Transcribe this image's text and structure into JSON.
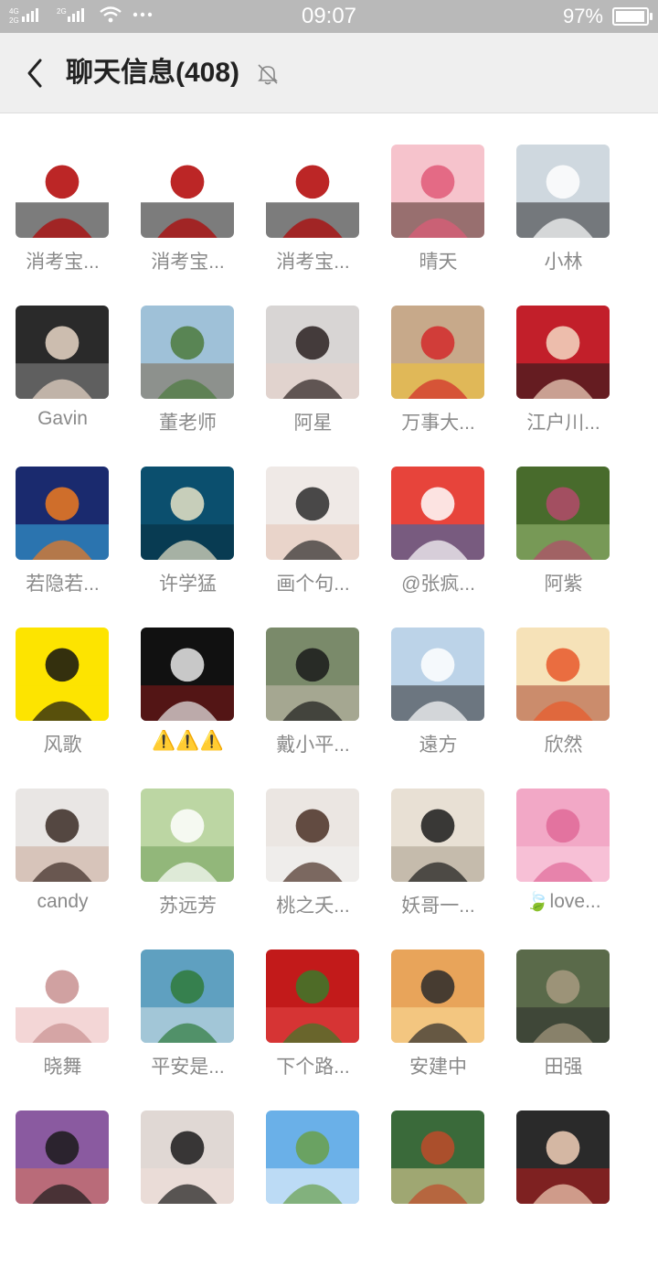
{
  "status_bar": {
    "network": "4G",
    "time": "09:07",
    "battery": "97%",
    "battery_level": 0.97
  },
  "header": {
    "title": "聊天信息(408)",
    "back_icon": "back-arrow-icon",
    "mute_icon": "bell-muted-icon"
  },
  "members": [
    {
      "name": "消考宝...",
      "avatar": [
        "#ffffff",
        "#b00000",
        "#111111"
      ]
    },
    {
      "name": "消考宝...",
      "avatar": [
        "#ffffff",
        "#b00000",
        "#111111"
      ]
    },
    {
      "name": "消考宝...",
      "avatar": [
        "#ffffff",
        "#b00000",
        "#111111"
      ]
    },
    {
      "name": "晴天",
      "avatar": [
        "#f6c3cc",
        "#e05b78",
        "#4a2a22"
      ]
    },
    {
      "name": "小林",
      "avatar": [
        "#cfd8df",
        "#ffffff",
        "#2a2a2a"
      ]
    },
    {
      "name": "Gavin",
      "avatar": [
        "#2a2a2a",
        "#e9d7c7",
        "#8b8b8b"
      ]
    },
    {
      "name": "董老师",
      "avatar": [
        "#9fc1d8",
        "#4c7a3d",
        "#7e6a50"
      ]
    },
    {
      "name": "阿星",
      "avatar": [
        "#d8d5d4",
        "#2a2020",
        "#e9d2c8"
      ]
    },
    {
      "name": "万事大...",
      "avatar": [
        "#c7a98a",
        "#d22a2a",
        "#f4c430"
      ]
    },
    {
      "name": "江户川...",
      "avatar": [
        "#c21f2a",
        "#f4d9c3",
        "#1a1a1a"
      ]
    },
    {
      "name": "若隐若...",
      "avatar": [
        "#1a2a6e",
        "#f07a20",
        "#3ab0e5"
      ]
    },
    {
      "name": "许学猛",
      "avatar": [
        "#0b4f6e",
        "#e9e4c8",
        "#072c3d"
      ]
    },
    {
      "name": "画个句...",
      "avatar": [
        "#efe9e6",
        "#2b2b2b",
        "#e3c3b3"
      ]
    },
    {
      "name": "@张疯...",
      "avatar": [
        "#e7443b",
        "#ffffff",
        "#1d6fb8"
      ]
    },
    {
      "name": "阿紫",
      "avatar": [
        "#486b2c",
        "#b44a6b",
        "#9fc07a"
      ]
    },
    {
      "name": "风歌",
      "avatar": [
        "#fde400",
        "#111111",
        "#fde400"
      ]
    },
    {
      "name": "⚠️⚠️⚠️",
      "avatar": [
        "#111111",
        "#e9e9e9",
        "#8a1a1a"
      ]
    },
    {
      "name": "戴小平...",
      "avatar": [
        "#7a8a6a",
        "#1a1a1a",
        "#c9c0b0"
      ]
    },
    {
      "name": "遠方",
      "avatar": [
        "#bcd3e8",
        "#ffffff",
        "#2a2a2a"
      ]
    },
    {
      "name": "欣然",
      "avatar": [
        "#f6e2b8",
        "#e8582a",
        "#a8452e"
      ]
    },
    {
      "name": "candy",
      "avatar": [
        "#e9e6e4",
        "#3a2a24",
        "#c9a898"
      ]
    },
    {
      "name": "苏远芳",
      "avatar": [
        "#bcd6a3",
        "#ffffff",
        "#6f9e5a"
      ]
    },
    {
      "name": "桃之夭...",
      "avatar": [
        "#ebe6e2",
        "#4a2f25",
        "#f2f2f2"
      ]
    },
    {
      "name": "妖哥一...",
      "avatar": [
        "#e8e0d4",
        "#1a1a1a",
        "#a89c8a"
      ]
    },
    {
      "name": "🍃love...",
      "avatar": [
        "#f2a8c6",
        "#e06a98",
        "#fbd4e4"
      ]
    },
    {
      "name": "晓舞",
      "avatar": [
        "#ffffff",
        "#c89090",
        "#e9b4b4"
      ]
    },
    {
      "name": "平安是...",
      "avatar": [
        "#5fa0c0",
        "#2f7a3a",
        "#d8e6ea"
      ]
    },
    {
      "name": "下个路...",
      "avatar": [
        "#c21a1a",
        "#3a7a2a",
        "#e84a4a"
      ]
    },
    {
      "name": "安建中",
      "avatar": [
        "#e8a45a",
        "#2a2a2a",
        "#fbe2a0"
      ]
    },
    {
      "name": "田强",
      "avatar": [
        "#5a6a4a",
        "#a89a80",
        "#2a2a2a"
      ]
    },
    {
      "name": "",
      "avatar": [
        "#8a5aa0",
        "#1a1a1a",
        "#e07a5a"
      ]
    },
    {
      "name": "",
      "avatar": [
        "#e0d8d4",
        "#1a1a1a",
        "#f2e0d8"
      ]
    },
    {
      "name": "",
      "avatar": [
        "#6ab0e8",
        "#6aa04a",
        "#ffffff"
      ]
    },
    {
      "name": "",
      "avatar": [
        "#3a6a3a",
        "#c04a2a",
        "#f2d8a0"
      ]
    },
    {
      "name": "",
      "avatar": [
        "#2a2a2a",
        "#f2d0b8",
        "#c21a1a"
      ]
    }
  ]
}
